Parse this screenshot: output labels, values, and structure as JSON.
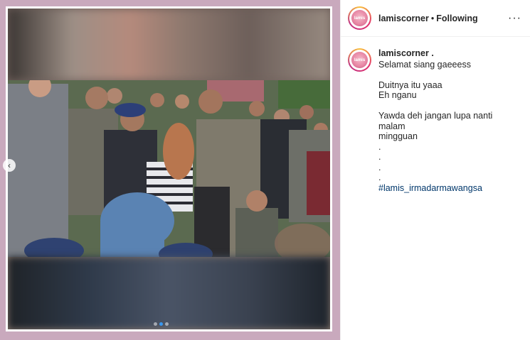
{
  "post": {
    "username": "lamiscorner",
    "separator": "•",
    "follow_state": "Following",
    "more_label": "···",
    "avatar_text": "lamis"
  },
  "caption": {
    "username": "lamiscorner .",
    "lines": [
      "Selamat siang gaeeess",
      "",
      "Duitnya itu yaaa",
      "Eh nganu",
      "",
      "Yawda deh jangan lupa nanti malam",
      "mingguan",
      ".",
      ".",
      ".",
      "."
    ],
    "hashtag": "#lamis_irmadarmawangsa"
  },
  "carousel": {
    "prev_label": "‹",
    "dot_count": 3,
    "active_index": 1
  },
  "colors": {
    "frame_bg": "#c9a9bd",
    "link": "#00376b",
    "active_dot": "#3897f0"
  }
}
